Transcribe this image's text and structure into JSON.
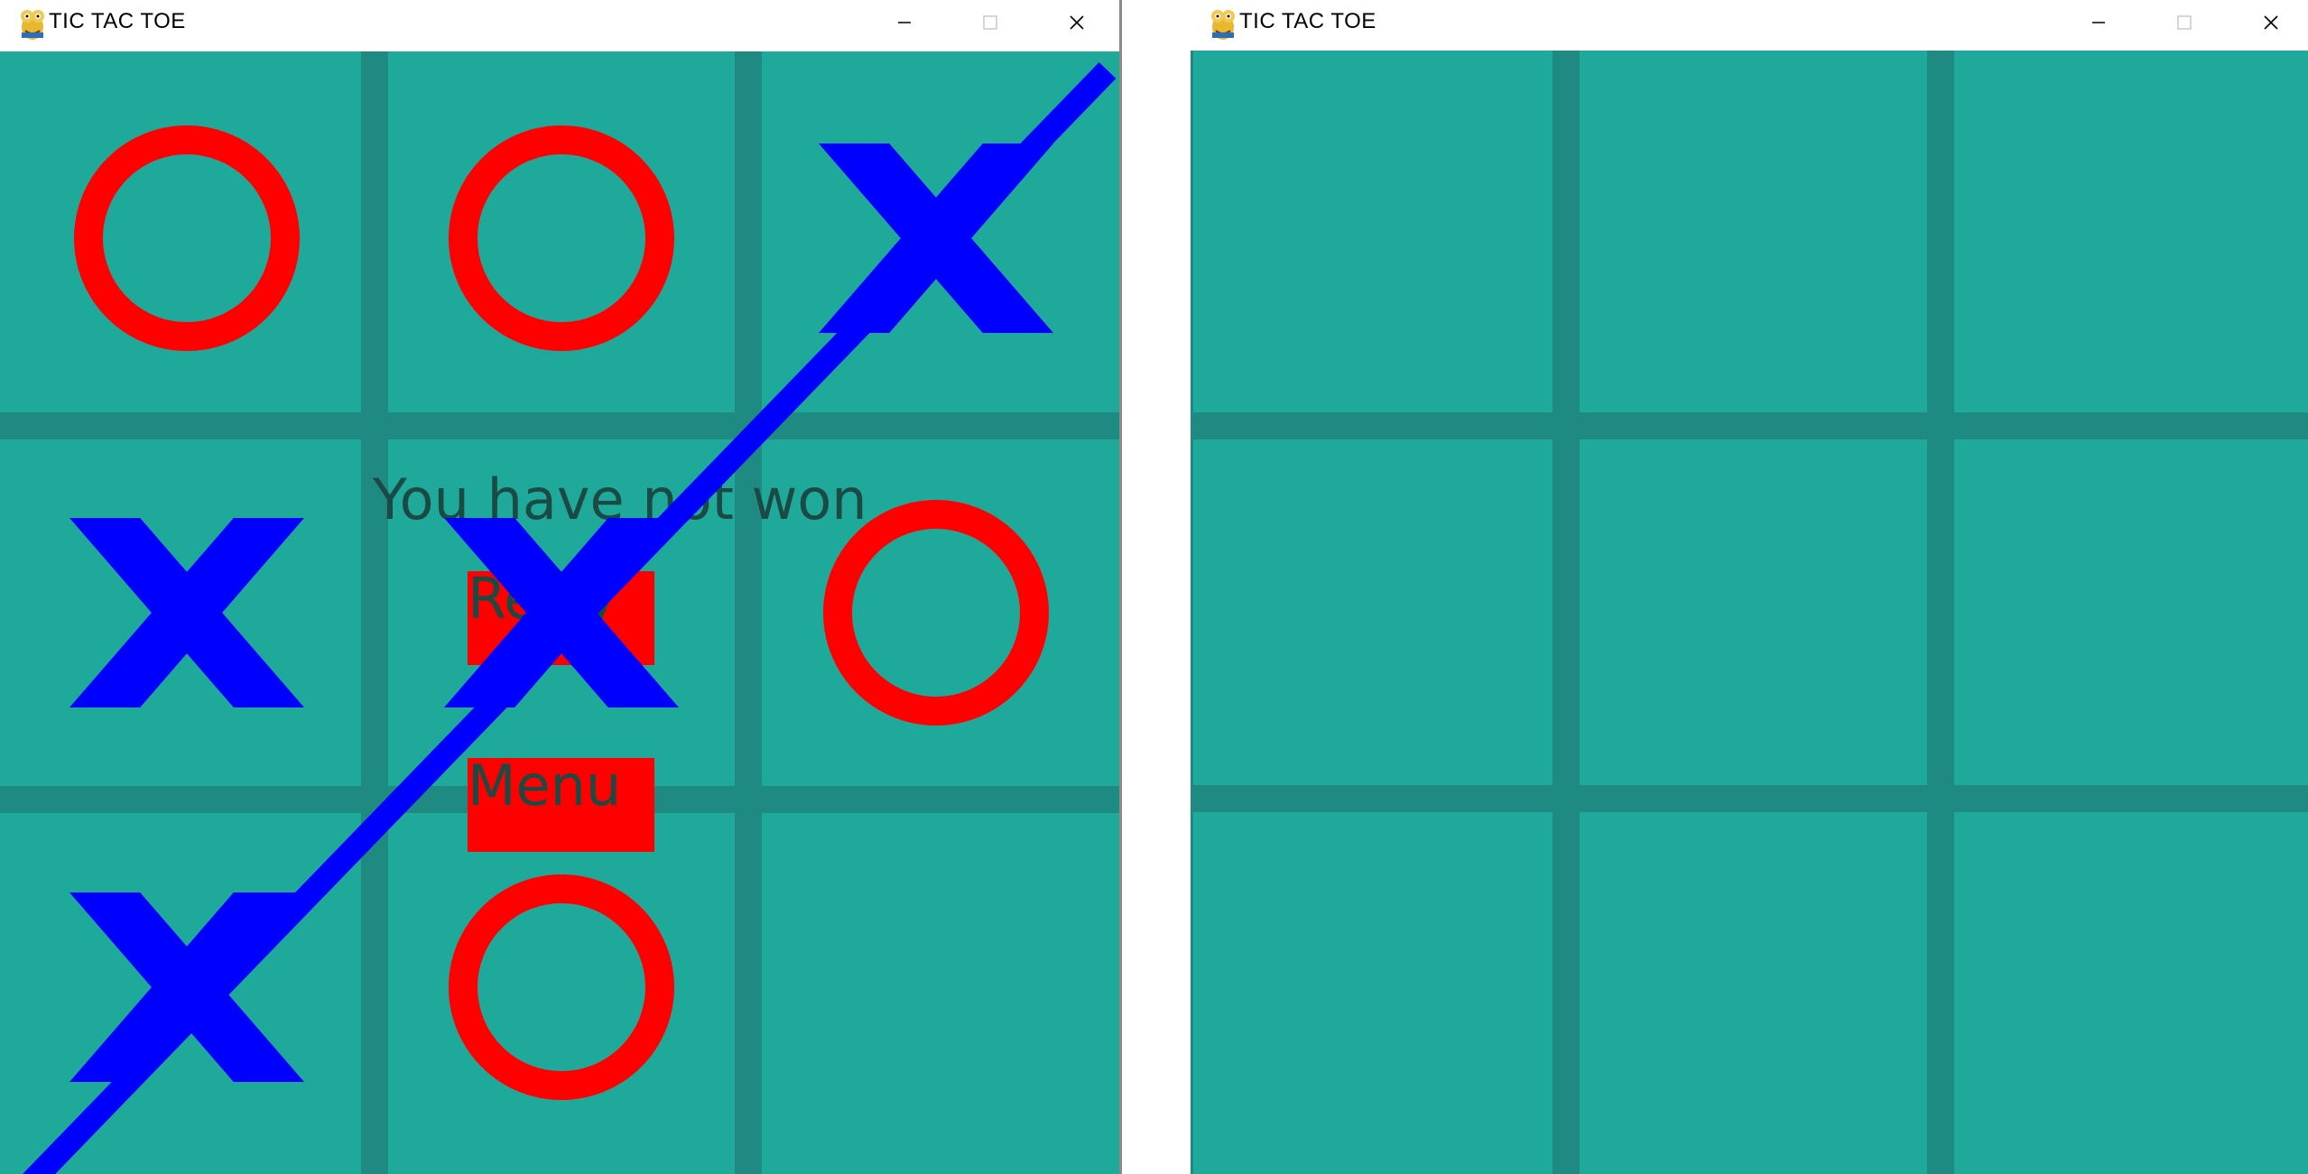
{
  "windows": [
    {
      "title": "TIC TAC TOE",
      "board": [
        "O",
        "O",
        "X",
        "X",
        "X",
        "O",
        "X",
        "O",
        ""
      ],
      "win_line": [
        6,
        2
      ],
      "message": "You have not won",
      "buttons": {
        "retry_label": "Retry",
        "menu_label": "Menu"
      }
    },
    {
      "title": "TIC TAC TOE",
      "board": [
        "",
        "",
        "",
        "",
        "",
        "",
        "",
        "",
        ""
      ]
    }
  ],
  "titlebar_controls": [
    "minimize-icon",
    "maximize-icon",
    "close-icon"
  ],
  "colors": {
    "board_background": "#1fa99b",
    "grid_lines": "#1f8a81",
    "o_mark": "#ff0000",
    "x_mark": "#0000ff",
    "win_line": "#0000ff",
    "button_fill": "#ff0000",
    "message_text": "#1b4a45"
  }
}
